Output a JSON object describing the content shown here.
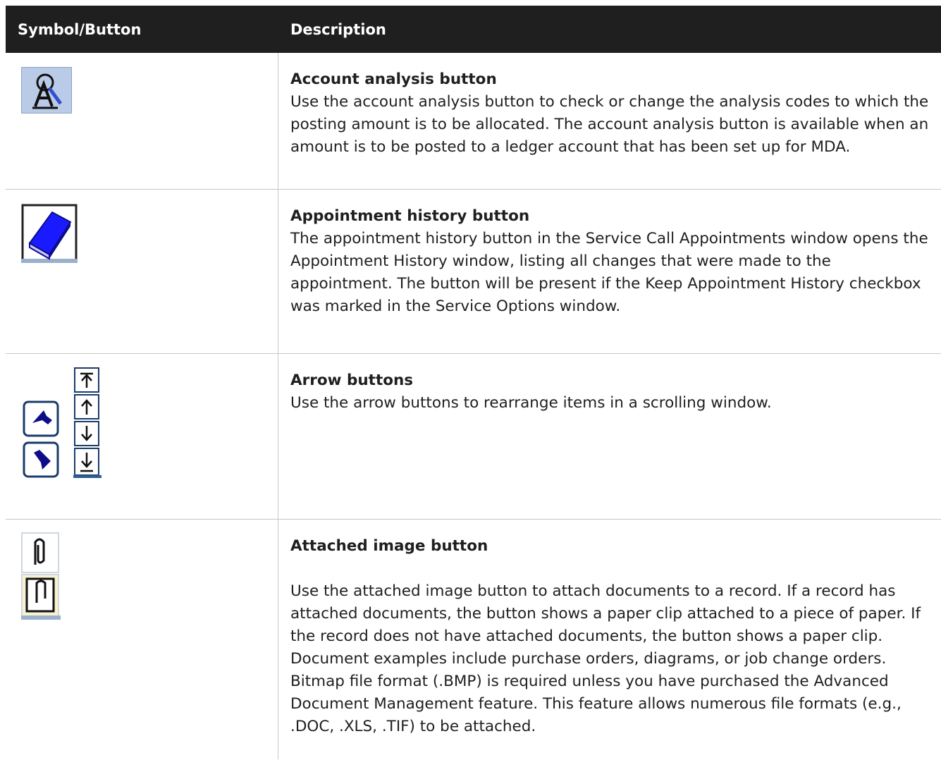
{
  "header": {
    "col1": "Symbol/Button",
    "col2": "Description"
  },
  "rows": [
    {
      "title": "Account analysis button",
      "body": "Use the account analysis button to check or change the analysis codes to which the posting amount is to be allocated. The account analysis button is available when an amount is to be posted to a ledger account that has been set up for MDA.",
      "icon": "account-analysis-icon"
    },
    {
      "title": "Appointment history button",
      "body": "The appointment history button in the Service Call Appointments window opens the Appointment History window, listing all changes that were made to the appointment. The button will be present if the Keep Appointment History checkbox was marked in the Service Options window.",
      "icon": "book-icon"
    },
    {
      "title": "Arrow buttons",
      "body": "Use the arrow buttons to rearrange items in a scrolling window.",
      "icon": "arrow-icons"
    },
    {
      "title": "Attached image button",
      "body": "Use the attached image button to attach documents to a record. If a record has attached documents, the button shows a paper clip attached to a piece of paper. If the record does not have attached documents, the button shows a paper clip. Document examples include purchase orders, diagrams, or job change orders. Bitmap file format (.BMP) is required unless you have purchased the Advanced Document Management feature. This feature allows numerous file formats (e.g., .DOC, .XLS, .TIF) to be attached.",
      "icon": "paperclip-icon"
    }
  ],
  "colors": {
    "header_bg": "#1f1f1f",
    "grid": "#c8c8c8",
    "icon_blue": "#1a1aff"
  }
}
